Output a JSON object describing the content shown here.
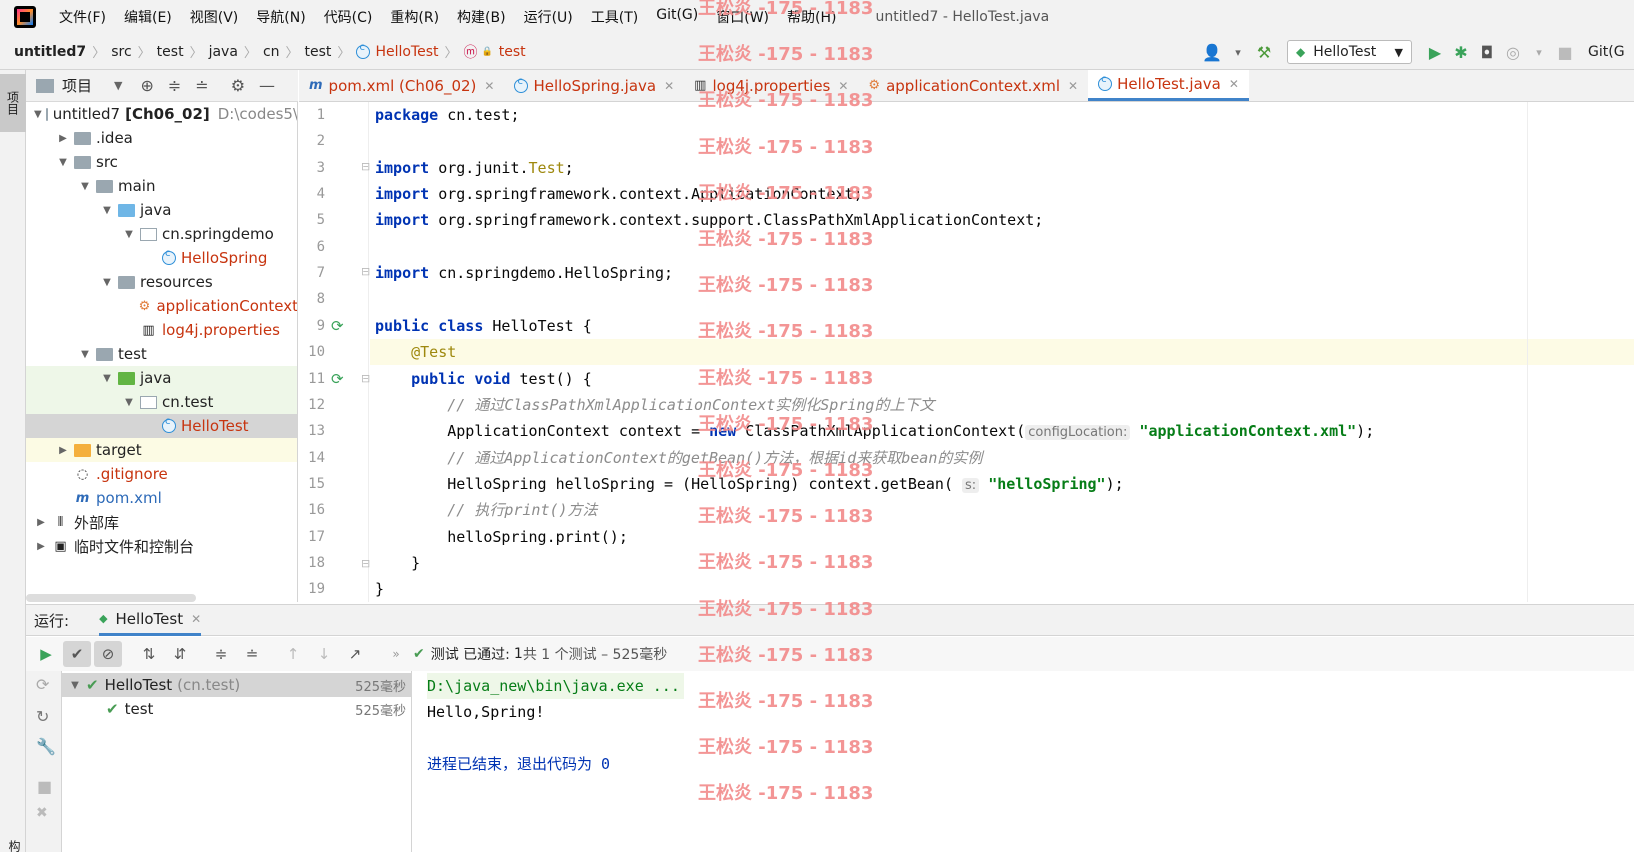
{
  "menubar": {
    "items": [
      "文件(F)",
      "编辑(E)",
      "视图(V)",
      "导航(N)",
      "代码(C)",
      "重构(R)",
      "构建(B)",
      "运行(U)",
      "工具(T)",
      "Git(G)",
      "窗口(W)",
      "帮助(H)"
    ],
    "title": "untitled7 - HelloTest.java"
  },
  "breadcrumb": {
    "items": [
      "untitled7",
      "src",
      "test",
      "java",
      "cn",
      "test",
      "HelloTest",
      "test"
    ]
  },
  "toolbar": {
    "run_config": "HelloTest",
    "git_label": "Git(G"
  },
  "left_strip": {
    "project_label": "项目",
    "bottom_label": "构"
  },
  "project": {
    "header": "项目",
    "tree": [
      {
        "label": "untitled7",
        "suffix": "[Ch06_02]",
        "path": "D:\\codes5\\",
        "depth": 0,
        "arrow": "v",
        "icon": "module"
      },
      {
        "label": ".idea",
        "depth": 1,
        "arrow": ">",
        "icon": "folder"
      },
      {
        "label": "src",
        "depth": 1,
        "arrow": "v",
        "icon": "folder"
      },
      {
        "label": "main",
        "depth": 2,
        "arrow": "v",
        "icon": "folder"
      },
      {
        "label": "java",
        "depth": 3,
        "arrow": "v",
        "icon": "folder-blue"
      },
      {
        "label": "cn.springdemo",
        "depth": 4,
        "arrow": "v",
        "icon": "package"
      },
      {
        "label": "HelloSpring",
        "depth": 5,
        "arrow": "",
        "icon": "class",
        "color": "#c7340f"
      },
      {
        "label": "resources",
        "depth": 3,
        "arrow": "v",
        "icon": "folder-res"
      },
      {
        "label": "applicationContext",
        "depth": 4,
        "arrow": "",
        "icon": "xml",
        "color": "#c7340f"
      },
      {
        "label": "log4j.properties",
        "depth": 4,
        "arrow": "",
        "icon": "props",
        "color": "#c7340f"
      },
      {
        "label": "test",
        "depth": 2,
        "arrow": "v",
        "icon": "folder"
      },
      {
        "label": "java",
        "depth": 3,
        "arrow": "v",
        "icon": "folder-green",
        "bg": "#eef7e8"
      },
      {
        "label": "cn.test",
        "depth": 4,
        "arrow": "v",
        "icon": "package",
        "bg": "#eef7e8"
      },
      {
        "label": "HelloTest",
        "depth": 5,
        "arrow": "",
        "icon": "class",
        "color": "#c7340f",
        "bg": "#d5d5d5"
      },
      {
        "label": "target",
        "depth": 1,
        "arrow": ">",
        "icon": "folder-orange",
        "bg": "#fcfbe4"
      },
      {
        "label": ".gitignore",
        "depth": 1,
        "arrow": "",
        "icon": "file",
        "color": "#c7340f"
      },
      {
        "label": "pom.xml",
        "depth": 1,
        "arrow": "",
        "icon": "maven",
        "color": "#2d6ab8"
      },
      {
        "label": "外部库",
        "depth": 0,
        "arrow": ">",
        "icon": "lib"
      },
      {
        "label": "临时文件和控制台",
        "depth": 0,
        "arrow": ">",
        "icon": "scratch"
      }
    ]
  },
  "tabs": [
    {
      "label": "pom.xml (Ch06_02)",
      "color": "#c7340f",
      "active": false,
      "icon": "maven"
    },
    {
      "label": "HelloSpring.java",
      "color": "#c7340f",
      "active": false,
      "icon": "class"
    },
    {
      "label": "log4j.properties",
      "color": "#c7340f",
      "active": false,
      "icon": "props"
    },
    {
      "label": "applicationContext.xml",
      "color": "#c7340f",
      "active": false,
      "icon": "xml"
    },
    {
      "label": "HelloTest.java",
      "color": "#c7340f",
      "active": true,
      "icon": "class"
    }
  ],
  "code": {
    "lines": [
      [
        {
          "t": "package ",
          "c": "kw"
        },
        {
          "t": "cn.test;",
          "c": ""
        }
      ],
      [],
      [
        {
          "t": "import ",
          "c": "kw"
        },
        {
          "t": "org.junit.",
          "c": ""
        },
        {
          "t": "Test",
          "c": "cls"
        },
        {
          "t": ";",
          "c": ""
        }
      ],
      [
        {
          "t": "import ",
          "c": "kw"
        },
        {
          "t": "org.springframework.context.ApplicationContext;",
          "c": ""
        }
      ],
      [
        {
          "t": "import ",
          "c": "kw"
        },
        {
          "t": "org.springframework.context.support.ClassPathXmlApplicationContext;",
          "c": ""
        }
      ],
      [],
      [
        {
          "t": "import ",
          "c": "kw"
        },
        {
          "t": "cn.springdemo.HelloSpring;",
          "c": ""
        }
      ],
      [],
      [
        {
          "t": "public class ",
          "c": "kw"
        },
        {
          "t": "HelloTest {",
          "c": ""
        }
      ],
      [
        {
          "t": "    ",
          "c": ""
        },
        {
          "t": "@Test",
          "c": "ann"
        }
      ],
      [
        {
          "t": "    ",
          "c": ""
        },
        {
          "t": "public void ",
          "c": "kw"
        },
        {
          "t": "test() {",
          "c": ""
        }
      ],
      [
        {
          "t": "        ",
          "c": ""
        },
        {
          "t": "// 通过ClassPathXmlApplicationContext实例化Spring的上下文",
          "c": "cm"
        }
      ],
      [
        {
          "t": "        ApplicationContext context = ",
          "c": ""
        },
        {
          "t": "new ",
          "c": "kw"
        },
        {
          "t": "ClassPathXmlApplicationContext(",
          "c": ""
        },
        {
          "t": "configLocation:",
          "c": "hint"
        },
        {
          "t": " ",
          "c": ""
        },
        {
          "t": "\"applicationContext.xml\"",
          "c": "str"
        },
        {
          "t": ");",
          "c": ""
        }
      ],
      [
        {
          "t": "        ",
          "c": ""
        },
        {
          "t": "// 通过ApplicationContext的getBean()方法，根据id来获取bean的实例",
          "c": "cm"
        }
      ],
      [
        {
          "t": "        HelloSpring helloSpring = (HelloSpring) context.getBean( ",
          "c": ""
        },
        {
          "t": "s:",
          "c": "hint"
        },
        {
          "t": " ",
          "c": ""
        },
        {
          "t": "\"helloSpring\"",
          "c": "str"
        },
        {
          "t": ");",
          "c": ""
        }
      ],
      [
        {
          "t": "        ",
          "c": ""
        },
        {
          "t": "// 执行print()方法",
          "c": "cm"
        }
      ],
      [
        {
          "t": "        helloSpring.print();",
          "c": ""
        }
      ],
      [
        {
          "t": "    }",
          "c": ""
        }
      ],
      [
        {
          "t": "}",
          "c": ""
        }
      ]
    ],
    "highlight_line": 10
  },
  "watermark": "王松炎 -175 - 1183",
  "run": {
    "label": "运行:",
    "tab": "HelloTest",
    "status_prefix": "测试 已通过:",
    "status_count": "1",
    "status_rest": "共 1 个测试 – 525毫秒",
    "tests": [
      {
        "name": "HelloTest",
        "sub": "(cn.test)",
        "time": "525毫秒",
        "depth": 0
      },
      {
        "name": "test",
        "sub": "",
        "time": "525毫秒",
        "depth": 1
      }
    ],
    "console": [
      {
        "text": "D:\\java_new\\bin\\java.exe ...",
        "color": "#067d17",
        "bg": "#eef7e8"
      },
      {
        "text": "Hello,Spring!",
        "color": "#080808"
      },
      {
        "text": "",
        "color": "#080808"
      },
      {
        "text": "进程已结束，退出代码为 0",
        "color": "#0033b3"
      }
    ]
  }
}
